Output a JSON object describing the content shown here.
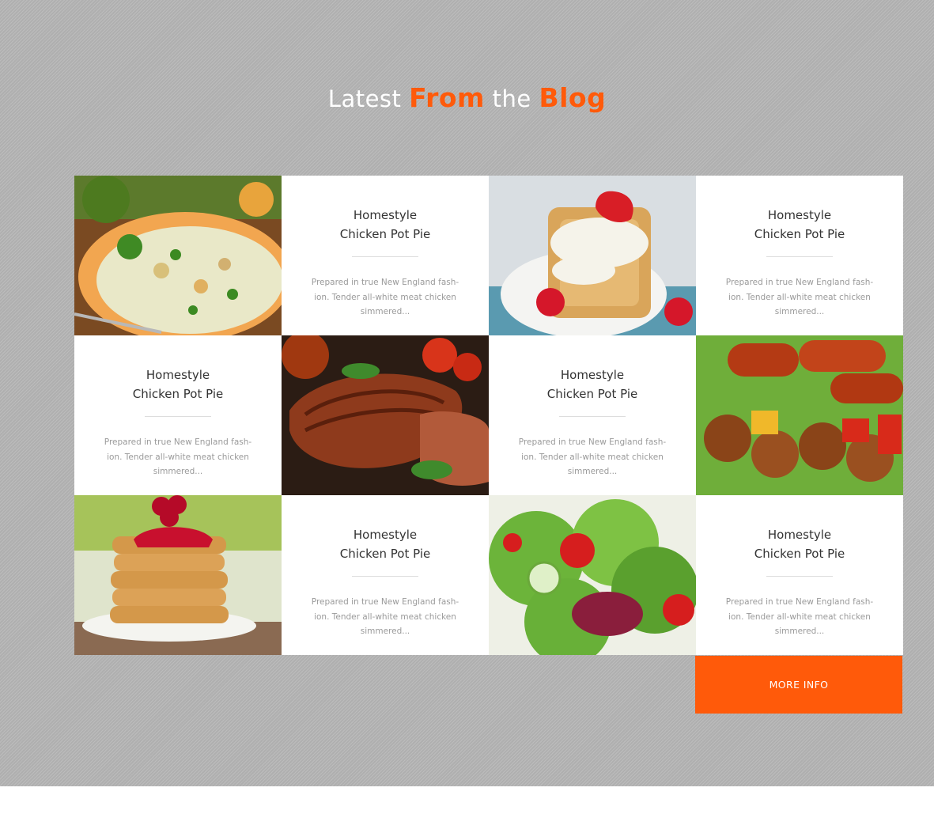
{
  "section": {
    "heading": {
      "part1": "Latest",
      "part2": "From",
      "part3": "the",
      "part4": "Blog"
    },
    "accent_color": "#ff5a0a",
    "posts": [
      {
        "title": "Homestyle\nChicken Pot Pie",
        "excerpt": "Prepared in true New England fash-\nion. Tender all-white meat chicken\nsimmered...",
        "image": "creamy-pot-pie-photo"
      },
      {
        "title": "Homestyle\nChicken Pot Pie",
        "excerpt": "Prepared in true New England fash-\nion. Tender all-white meat chicken\nsimmered...",
        "image": "strawberry-waffles-photo"
      },
      {
        "title": "Homestyle\nChicken Pot Pie",
        "excerpt": "Prepared in true New England fash-\nion. Tender all-white meat chicken\nsimmered...",
        "image": "grilled-steak-photo"
      },
      {
        "title": "Homestyle\nChicken Pot Pie",
        "excerpt": "Prepared in true New England fash-\nion. Tender all-white meat chicken\nsimmered...",
        "image": "sausage-skewers-photo"
      },
      {
        "title": "Homestyle\nChicken Pot Pie",
        "excerpt": "Prepared in true New England fash-\nion. Tender all-white meat chicken\nsimmered...",
        "image": "pancake-stack-photo"
      },
      {
        "title": "Homestyle\nChicken Pot Pie",
        "excerpt": "Prepared in true New England fash-\nion. Tender all-white meat chicken\nsimmered...",
        "image": "green-salad-photo"
      }
    ],
    "more_button": "MORE INFO"
  }
}
